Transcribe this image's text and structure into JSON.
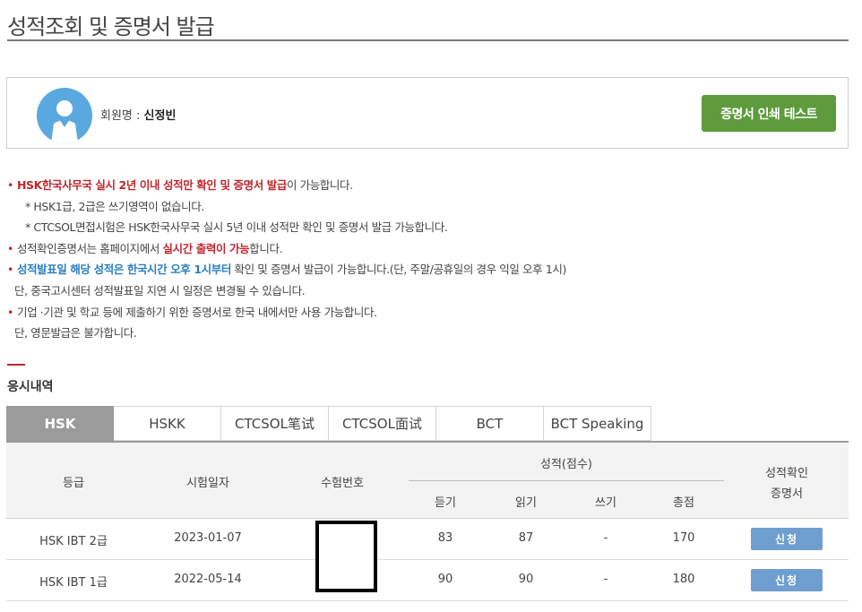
{
  "page": {
    "title": "성적조회 및 증명서 발급"
  },
  "member": {
    "label": "회원명 : ",
    "name": "신정빈",
    "print_button": "증명서 인쇄 테스트",
    "colors": {
      "avatar": "#5aa8e0",
      "print_button": "#5e9b3d"
    }
  },
  "notices": {
    "line1_red": "HSK한국사무국 실시 2년 이내 성적만 확인 및 증명서 발급",
    "line1_rest": "이 가능합니다.",
    "line2": "* HSK1급, 2급은 쓰기영역이 없습니다.",
    "line3": "* CTCSOL면접시험은 HSK한국사무국 실시 5년 이내 성적만 확인 및 증명서 발급 가능합니다.",
    "line4_pre": "성적확인증명서는 홈페이지에서 ",
    "line4_red": "실시간 출력이 가능",
    "line4_post": "합니다.",
    "line5_blue": "성적발표일 해당 성적은 한국시간 오후 1시부터",
    "line5_rest": " 확인 및 증명서 발급이 가능합니다.(단, 주말/공휴일의 경우 익일 오후 1시)",
    "line6": "단, 중국고시센터 성적발표일 지연 시 일정은 변경될 수 있습니다.",
    "line7": "기업 ·기관 및 학교 등에 제출하기 위한 증명서로 한국 내에서만 사용 가능합니다.",
    "line8": "단, 영문발급은 불가합니다.",
    "bullet": "•"
  },
  "history": {
    "title": "응시내역",
    "tabs": [
      "HSK",
      "HSKK",
      "CTCSOL笔试",
      "CTCSOL面试",
      "BCT",
      "BCT Speaking"
    ],
    "active_tab": "HSK",
    "headers": {
      "grade": "등급",
      "date": "시험일자",
      "exam_no": "수험번호",
      "score": "성적(점수)",
      "listening": "듣기",
      "reading": "읽기",
      "writing": "쓰기",
      "total": "총점",
      "cert_line1": "성적확인",
      "cert_line2": "증명서"
    },
    "rows": [
      {
        "grade": "HSK IBT 2급",
        "date": "2023-01-07",
        "listening": "83",
        "reading": "87",
        "writing": "-",
        "total": "170",
        "apply": "신청"
      },
      {
        "grade": "HSK IBT 1급",
        "date": "2022-05-14",
        "listening": "90",
        "reading": "90",
        "writing": "-",
        "total": "180",
        "apply": "신청"
      }
    ]
  }
}
